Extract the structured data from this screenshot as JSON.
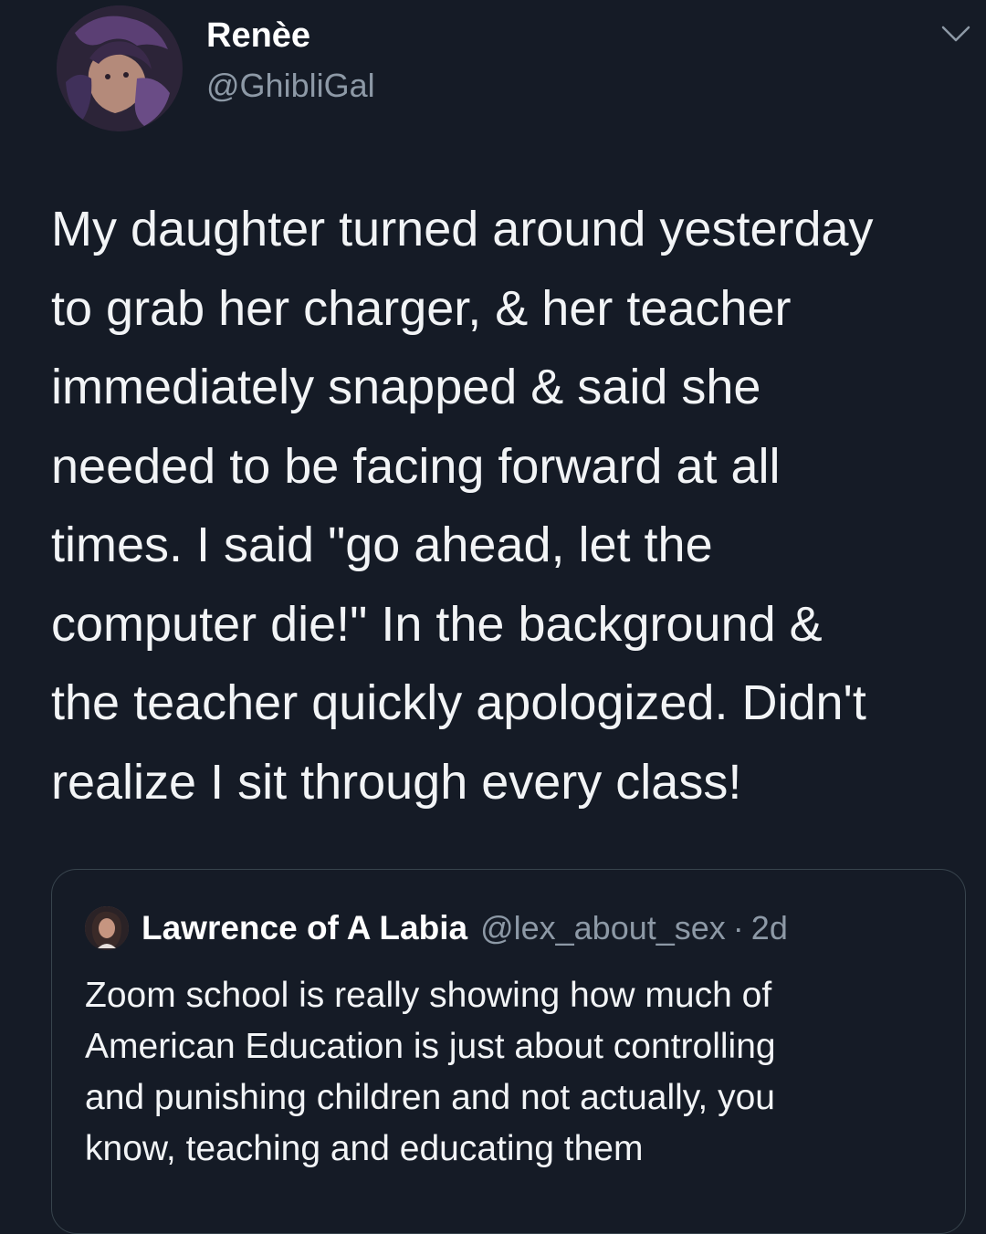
{
  "tweet": {
    "author": {
      "display_name": "Renèe",
      "handle": "@GhibliGal",
      "avatar_icon": "avatar-icon"
    },
    "menu_icon": "chevron-down-icon",
    "text_lines": [
      "My daughter turned around yesterday",
      "to grab her charger, & her teacher",
      "immediately snapped & said she",
      "needed to be facing forward at all",
      "times. I said \"go ahead, let the",
      "computer die!\" In the background &",
      "the teacher quickly apologized. Didn't",
      "realize I sit through every class!"
    ]
  },
  "quoted_tweet": {
    "author": {
      "display_name": "Lawrence of A Labia",
      "handle": "@lex_about_sex",
      "separator": "·",
      "time": "2d",
      "avatar_icon": "avatar-icon"
    },
    "text_lines": [
      "Zoom school is really showing how much of",
      "American Education is just about controlling",
      "and punishing children and not actually, you",
      "know, teaching and educating them"
    ]
  },
  "colors": {
    "background": "#151b26",
    "text": "#f2f4f6",
    "secondary_text": "#8d99a6",
    "border": "#38444d"
  }
}
